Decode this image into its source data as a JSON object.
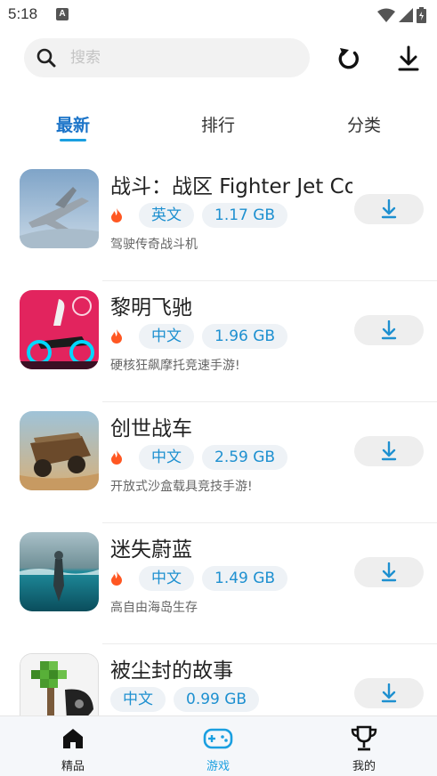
{
  "status_bar": {
    "time": "5:18",
    "notif_letter": "A"
  },
  "search": {
    "placeholder": "搜索"
  },
  "tabs": [
    {
      "label": "最新",
      "active": true
    },
    {
      "label": "排行",
      "active": false
    },
    {
      "label": "分类",
      "active": false
    }
  ],
  "apps": [
    {
      "title": "战斗：战区 Fighter Jet Co",
      "lang": "英文",
      "size": "1.17 GB",
      "desc": "驾驶传奇战斗机",
      "hot": true
    },
    {
      "title": "黎明飞驰",
      "lang": "中文",
      "size": "1.96 GB",
      "desc": "硬核狂飙摩托竞速手游!",
      "hot": true
    },
    {
      "title": "创世战车",
      "lang": "中文",
      "size": "2.59 GB",
      "desc": "开放式沙盒载具竞技手游!",
      "hot": true
    },
    {
      "title": "迷失蔚蓝",
      "lang": "中文",
      "size": "1.49 GB",
      "desc": "高自由海岛生存",
      "hot": true
    },
    {
      "title": "被尘封的故事",
      "lang": "中文",
      "size": "0.99 GB",
      "desc": "",
      "hot": false
    }
  ],
  "bottom_nav": [
    {
      "label": "精品",
      "icon": "home-icon",
      "active": false
    },
    {
      "label": "游戏",
      "icon": "gamepad-icon",
      "active": true
    },
    {
      "label": "我的",
      "icon": "trophy-icon",
      "active": false
    }
  ],
  "colors": {
    "accent": "#1a9fe0",
    "tag_text": "#1e90d0",
    "tag_bg": "#eef2f6",
    "fire": "#ff5722"
  }
}
